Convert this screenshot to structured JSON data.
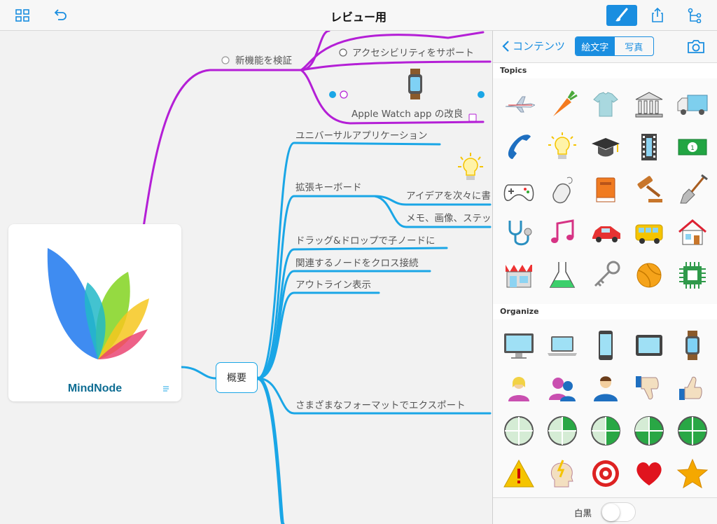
{
  "document": {
    "title": "レビュー用"
  },
  "toolbar": {
    "grid_icon": "grid-icon",
    "undo_icon": "undo-icon",
    "brush_icon": "brush-icon",
    "share_icon": "share-icon",
    "outline_icon": "outline-icon"
  },
  "mindmap": {
    "central": {
      "name": "MindNode"
    },
    "overview": "概要",
    "purple_branch": {
      "label": "新機能を検証",
      "children": [
        "アクセシビリティをサポート",
        "Apple Watch app の改良"
      ]
    },
    "blue_branch": {
      "items": [
        "ユニバーサルアプリケーション",
        "拡張キーボード",
        "アイデアを次々に書",
        "メモ、画像、ステッ",
        "ドラッグ&ドロップで子ノードに",
        "関連するノードをクロス接続",
        "アウトライン表示",
        "さまざまなフォーマットでエクスポート"
      ]
    },
    "colors": {
      "purple": "#b41fd6",
      "blue": "#1aa6e6"
    }
  },
  "sidebar": {
    "back_label": "コンテンツ",
    "tabs": [
      "絵文字",
      "写真"
    ],
    "active_tab": "絵文字",
    "sections": [
      {
        "title": "Topics",
        "icons": [
          "airplane-icon",
          "carrot-icon",
          "tshirt-icon",
          "bank-icon",
          "truck-icon",
          "phone-icon",
          "lightbulb-icon",
          "graduation-cap-icon",
          "film-strip-icon",
          "banknote-icon",
          "gamepad-icon",
          "mouse-icon",
          "book-icon",
          "gavel-icon",
          "shovel-icon",
          "stethoscope-icon",
          "music-note-icon",
          "car-icon",
          "bus-icon",
          "house-icon",
          "store-icon",
          "flask-icon",
          "key-icon",
          "ball-icon",
          "chip-icon"
        ]
      },
      {
        "title": "Organize",
        "icons": [
          "desktop-icon",
          "laptop-icon",
          "phone-device-icon",
          "tablet-icon",
          "watch-icon",
          "woman-icon",
          "group-icon",
          "man-icon",
          "thumbs-down-icon",
          "thumbs-up-icon",
          "progress-0-icon",
          "progress-25-icon",
          "progress-50-icon",
          "progress-75-icon",
          "progress-100-icon",
          "warning-icon",
          "idea-head-icon",
          "target-icon",
          "heart-icon",
          "star-icon"
        ]
      }
    ],
    "bw_label": "白黒",
    "bw_on": false
  }
}
